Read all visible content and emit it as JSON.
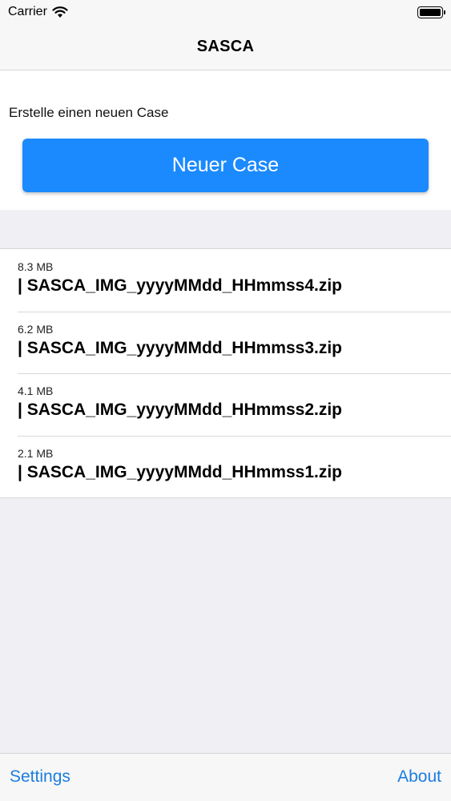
{
  "status_bar": {
    "carrier": "Carrier",
    "wifi_icon": "wifi-icon",
    "battery_icon": "battery-icon"
  },
  "nav": {
    "title": "SASCA"
  },
  "create": {
    "prompt": "Erstelle einen neuen Case",
    "button_label": "Neuer Case"
  },
  "files": [
    {
      "size": "8.3 MB",
      "name": "| SASCA_IMG_yyyyMMdd_HHmmss4.zip"
    },
    {
      "size": "6.2 MB",
      "name": "| SASCA_IMG_yyyyMMdd_HHmmss3.zip"
    },
    {
      "size": "4.1 MB",
      "name": "| SASCA_IMG_yyyyMMdd_HHmmss2.zip"
    },
    {
      "size": "2.1 MB",
      "name": "| SASCA_IMG_yyyyMMdd_HHmmss1.zip"
    }
  ],
  "toolbar": {
    "settings_label": "Settings",
    "about_label": "About"
  },
  "colors": {
    "accent": "#1b8aff",
    "link": "#1b7ee0",
    "background": "#efeff4"
  }
}
